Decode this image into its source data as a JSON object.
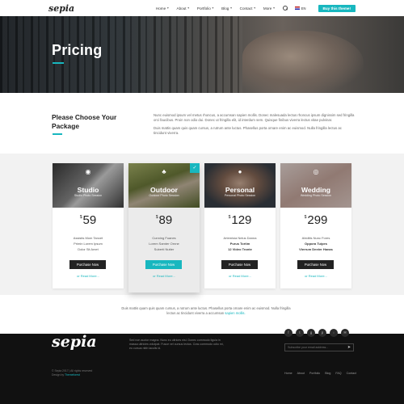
{
  "header": {
    "logo": "sepia",
    "nav": [
      {
        "label": "Home"
      },
      {
        "label": "About"
      },
      {
        "label": "Portfolio"
      },
      {
        "label": "Blog"
      },
      {
        "label": "Contact"
      },
      {
        "label": "More"
      }
    ],
    "lang": "EN",
    "buy_label": "Buy this theme!"
  },
  "hero": {
    "title": "Pricing"
  },
  "intro": {
    "title": "Please Choose Your Package",
    "paragraph1": "Nunc euismod ipsum vel metus rhoncus, a accumsan sapien mollis. Donec malesuada lectus rhoncus ipsum dignissim sed fringilla orci faucibus. Proin non odio dui. Donec ut fringilla elit, id interdum sem. Quisque finibus viverra lectus vitae pulvinar.",
    "paragraph2": "Duis mattis quam quis quam cursus, a rutrum ante luctus. Phasellus porta ornare enim ac euismod. Nulla fringilla lectus ac tincidunt viverra."
  },
  "packages": [
    {
      "name": "Studio",
      "subtitle": "Studio Photo Session",
      "currency": "$",
      "price": "59",
      "features": [
        "Assistis Mom Tancet",
        "Primin Lorem Ipsum",
        "Dolor Sit Amet"
      ],
      "buy_label": "Purchase Now",
      "more_label": "or Read More..."
    },
    {
      "name": "Outdoor",
      "subtitle": "Outdoor Photo Session",
      "currency": "$",
      "price": "89",
      "features": [
        "Cunning Fuanes",
        "Lorem Samter Ornne",
        "Suberti Nutter"
      ],
      "buy_label": "Purchase Now",
      "more_label": "or Read More..."
    },
    {
      "name": "Personal",
      "subtitle": "Personal Photo Session",
      "currency": "$",
      "price": "129",
      "features": [
        "Artemisia Nelus Danna",
        "Purus Tortim",
        "12 Video Tronte"
      ],
      "buy_label": "Purchase Now",
      "more_label": "or Read More..."
    },
    {
      "name": "Wedding",
      "subtitle": "Wedding Photo Session",
      "currency": "$",
      "price": "299",
      "features": [
        "Abiditis Nunc Fores",
        "Oppora Tuipes",
        "Vierrum Dexter Hanas"
      ],
      "buy_label": "Purchase Now",
      "more_label": "or Read More..."
    }
  ],
  "bottom_text": {
    "text": "Duis mattis quam quis quam cursus, a rutrum ante luctus. Phasellus porta ornare enim ac euismod. Nulla fringilla lectus ac tincidunt viverra a accumsan ",
    "link": "sapien mollis."
  },
  "footer": {
    "logo": "sepia",
    "about_title": "- Creative Photo Studio",
    "about_text": "Sed non auctor magna. Nunc eu ultrices nisl. Donec commodo ligula in massa ultricies volutpat. Fusce vel cursus lectus. Cras commodo odio mi, eu cursus nibh iaculis id.",
    "newsletter_placeholder": "Subscribe your email address...",
    "copyright_line1": "© Sepia 2017 | All rights reserved",
    "copyright_line2": "Design by",
    "theme_author": "Themeforest",
    "links": [
      "Home",
      "About",
      "Portfolio",
      "Blog",
      "FAQ",
      "Contact"
    ]
  },
  "colors": {
    "accent": "#18b7bf",
    "footer_bg": "#111111"
  }
}
